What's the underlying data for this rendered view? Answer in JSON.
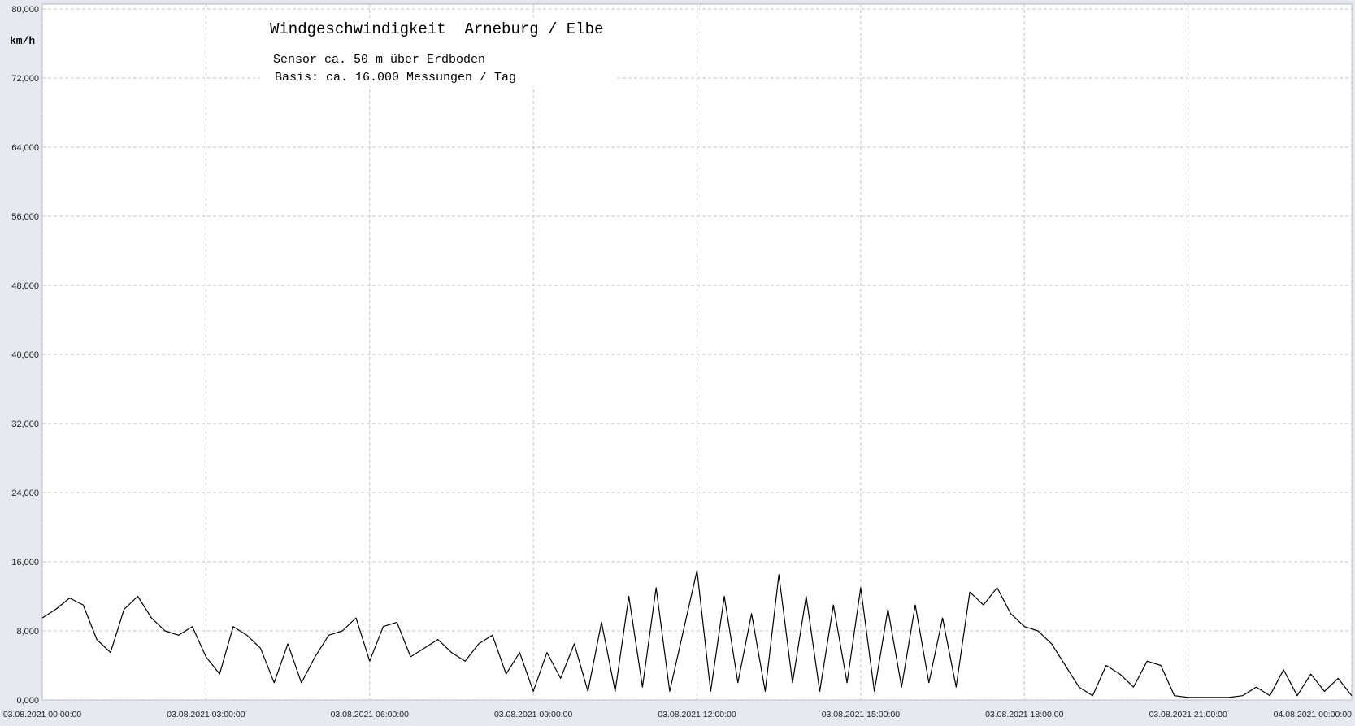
{
  "chart_data": {
    "type": "line",
    "title": "Windgeschwindigkeit  Arneburg / Elbe",
    "subtitle_lines": [
      "Sensor ca. 50 m über Erdboden",
      "Basis: ca. 16.000 Messungen / Tag"
    ],
    "ylabel": "km/h",
    "xlabel": "",
    "ylim": [
      0,
      80
    ],
    "y_ticks": [
      0,
      8,
      16,
      24,
      32,
      40,
      48,
      56,
      64,
      72,
      80
    ],
    "y_tick_labels": [
      "0,000",
      "8,000",
      "16,000",
      "24,000",
      "32,000",
      "40,000",
      "48,000",
      "56,000",
      "64,000",
      "72,000",
      "80,000"
    ],
    "x_unit": "hours since 03.08.2021 00:00:00",
    "xlim": [
      0,
      24
    ],
    "x_ticks": [
      0,
      3,
      6,
      9,
      12,
      15,
      18,
      21,
      24
    ],
    "x_tick_labels": [
      "03.08.2021  00:00:00",
      "03.08.2021  03:00:00",
      "03.08.2021  06:00:00",
      "03.08.2021  09:00:00",
      "03.08.2021  12:00:00",
      "03.08.2021  15:00:00",
      "03.08.2021  18:00:00",
      "03.08.2021  21:00:00",
      "04.08.2021  00:00:00"
    ],
    "grid": true,
    "line_color": "#000000",
    "series": [
      {
        "x": [
          0,
          0.25,
          0.5,
          0.75,
          1.0,
          1.25,
          1.5,
          1.75,
          2.0,
          2.25,
          2.5,
          2.75,
          3.0,
          3.25,
          3.5,
          3.75,
          4.0,
          4.25,
          4.5,
          4.75,
          5.0,
          5.25,
          5.5,
          5.75,
          6.0,
          6.25,
          6.5,
          6.75,
          7.0,
          7.25,
          7.5,
          7.75,
          8.0,
          8.25,
          8.5,
          8.75,
          9.0,
          9.25,
          9.5,
          9.75,
          10.0,
          10.25,
          10.5,
          10.75,
          11.0,
          11.25,
          11.5,
          11.75,
          12.0,
          12.25,
          12.5,
          12.75,
          13.0,
          13.25,
          13.5,
          13.75,
          14.0,
          14.25,
          14.5,
          14.75,
          15.0,
          15.25,
          15.5,
          15.75,
          16.0,
          16.25,
          16.5,
          16.75,
          17.0,
          17.25,
          17.5,
          17.75,
          18.0,
          18.25,
          18.5,
          18.75,
          19.0,
          19.25,
          19.5,
          19.75,
          20.0,
          20.25,
          20.5,
          20.75,
          21.0,
          21.25,
          21.5,
          21.75,
          22.0,
          22.25,
          22.5,
          22.75,
          23.0,
          23.25,
          23.5,
          23.75,
          24.0
        ],
        "y": [
          9.5,
          10.5,
          11.8,
          11.0,
          7.0,
          5.5,
          10.5,
          12.0,
          9.5,
          8.0,
          7.5,
          8.5,
          5.0,
          3.0,
          8.5,
          7.5,
          6.0,
          2.0,
          6.5,
          2.0,
          5.0,
          7.5,
          8.0,
          9.5,
          4.5,
          8.5,
          9.0,
          5.0,
          6.0,
          7.0,
          5.5,
          4.5,
          6.5,
          7.5,
          3.0,
          5.5,
          1.0,
          5.5,
          2.5,
          6.5,
          1.0,
          9.0,
          1.0,
          12.0,
          1.5,
          13.0,
          1.0,
          8.0,
          15.0,
          1.0,
          12.0,
          2.0,
          10.0,
          1.0,
          14.5,
          2.0,
          12.0,
          1.0,
          11.0,
          2.0,
          13.0,
          1.0,
          10.5,
          1.5,
          11.0,
          2.0,
          9.5,
          1.5,
          12.5,
          11.0,
          13.0,
          10.0,
          8.5,
          8.0,
          6.5,
          4.0,
          1.5,
          0.5,
          4.0,
          3.0,
          1.5,
          4.5,
          4.0,
          0.5,
          0.3,
          0.3,
          0.3,
          0.3,
          0.5,
          1.5,
          0.5,
          3.5,
          0.5,
          3.0,
          1.0,
          2.5,
          0.5
        ]
      }
    ]
  }
}
